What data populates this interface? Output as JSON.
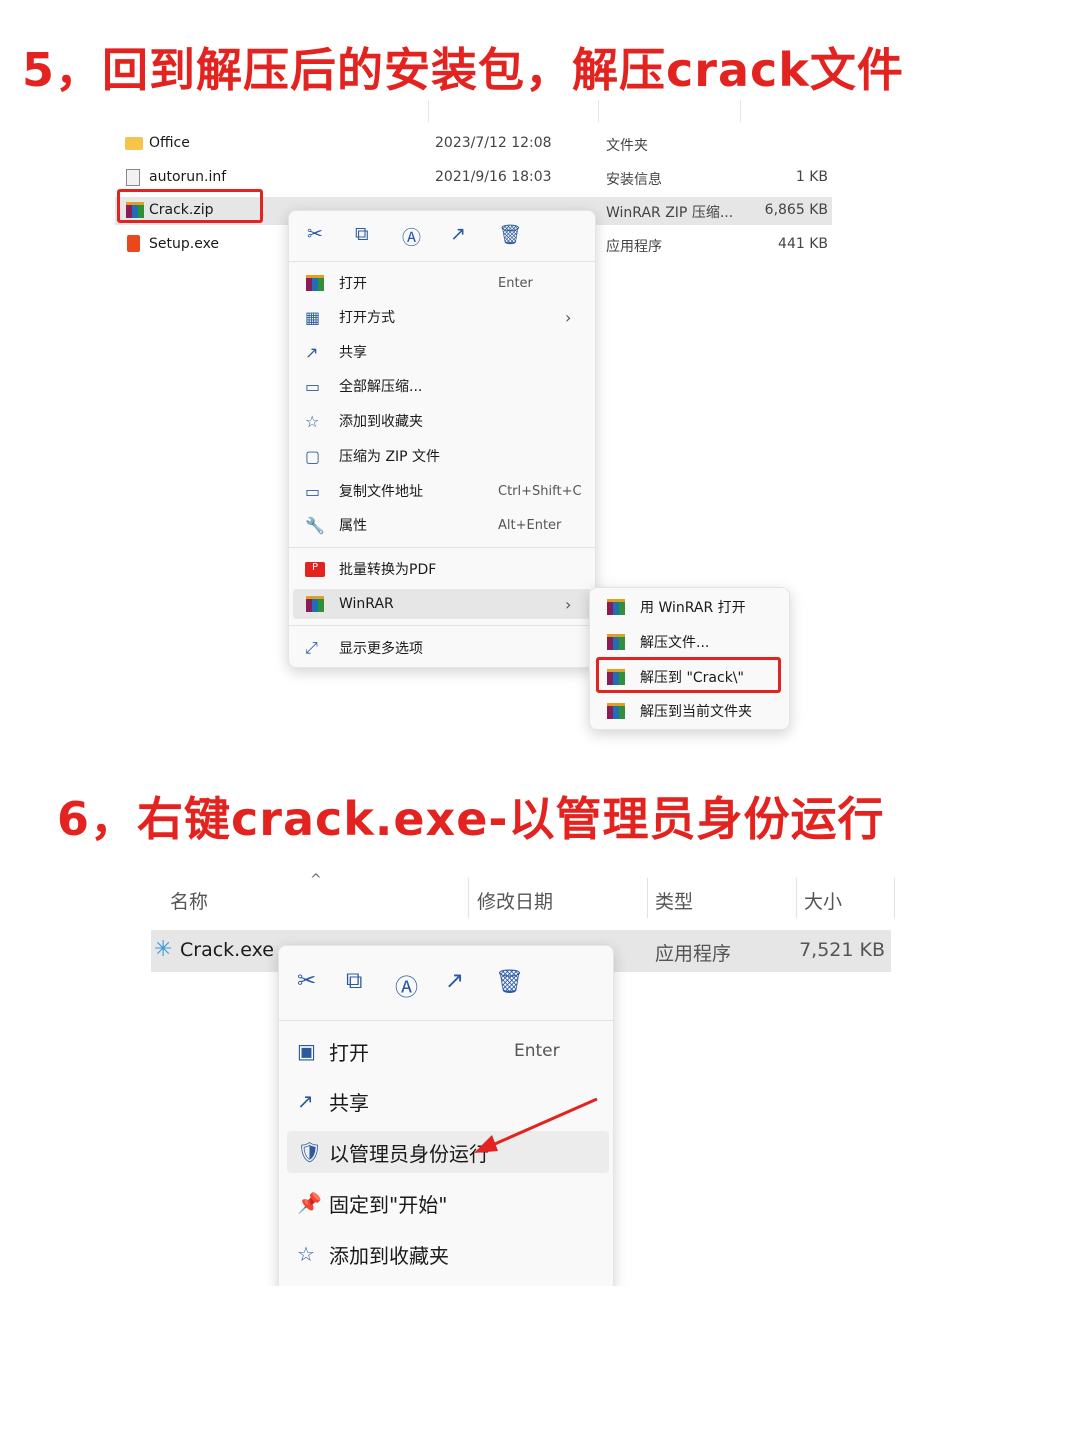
{
  "step5": {
    "title": "5，回到解压后的安装包，解压crack文件",
    "files": [
      {
        "name": "Office",
        "date": "2023/7/12 12:08",
        "type": "文件夹",
        "size": "",
        "icon": "folder-icon"
      },
      {
        "name": "autorun.inf",
        "date": "2021/9/16 18:03",
        "type": "安装信息",
        "size": "1 KB",
        "icon": "settings-file-icon"
      },
      {
        "name": "Crack.zip",
        "date": "",
        "type": "WinRAR ZIP 压缩...",
        "size": "6,865 KB",
        "icon": "winrar-icon"
      },
      {
        "name": "Setup.exe",
        "date": "",
        "type": "应用程序",
        "size": "441 KB",
        "icon": "office-icon"
      }
    ],
    "menu": {
      "toolbar": [
        "cut",
        "copy",
        "rename",
        "share",
        "delete"
      ],
      "items": [
        {
          "label": "打开",
          "shortcut": "Enter"
        },
        {
          "label": "打开方式",
          "shortcut": ""
        },
        {
          "label": "共享",
          "shortcut": ""
        },
        {
          "label": "全部解压缩...",
          "shortcut": ""
        },
        {
          "label": "添加到收藏夹",
          "shortcut": ""
        },
        {
          "label": "压缩为 ZIP 文件",
          "shortcut": ""
        },
        {
          "label": "复制文件地址",
          "shortcut": "Ctrl+Shift+C"
        },
        {
          "label": "属性",
          "shortcut": "Alt+Enter"
        },
        {
          "label": "批量转换为PDF",
          "shortcut": ""
        },
        {
          "label": "WinRAR",
          "shortcut": ""
        },
        {
          "label": "显示更多选项",
          "shortcut": ""
        }
      ]
    },
    "submenu": [
      "用 WinRAR 打开",
      "解压文件...",
      "解压到 \"Crack\\\"",
      "解压到当前文件夹"
    ]
  },
  "step6": {
    "title": "6，右键crack.exe-以管理员身份运行",
    "headers": {
      "name": "名称",
      "date": "修改日期",
      "type": "类型",
      "size": "大小",
      "sort": "^"
    },
    "file": {
      "name": "Crack.exe",
      "type": "应用程序",
      "size": "7,521 KB"
    },
    "menu": {
      "items": [
        {
          "label": "打开",
          "shortcut": "Enter"
        },
        {
          "label": "共享",
          "shortcut": ""
        },
        {
          "label": "以管理员身份运行",
          "shortcut": ""
        },
        {
          "label": "固定到\"开始\"",
          "shortcut": ""
        },
        {
          "label": "添加到收藏夹",
          "shortcut": ""
        }
      ]
    }
  },
  "colors": {
    "accent_red": "#e3231f",
    "highlight": "#e6e6e6"
  }
}
